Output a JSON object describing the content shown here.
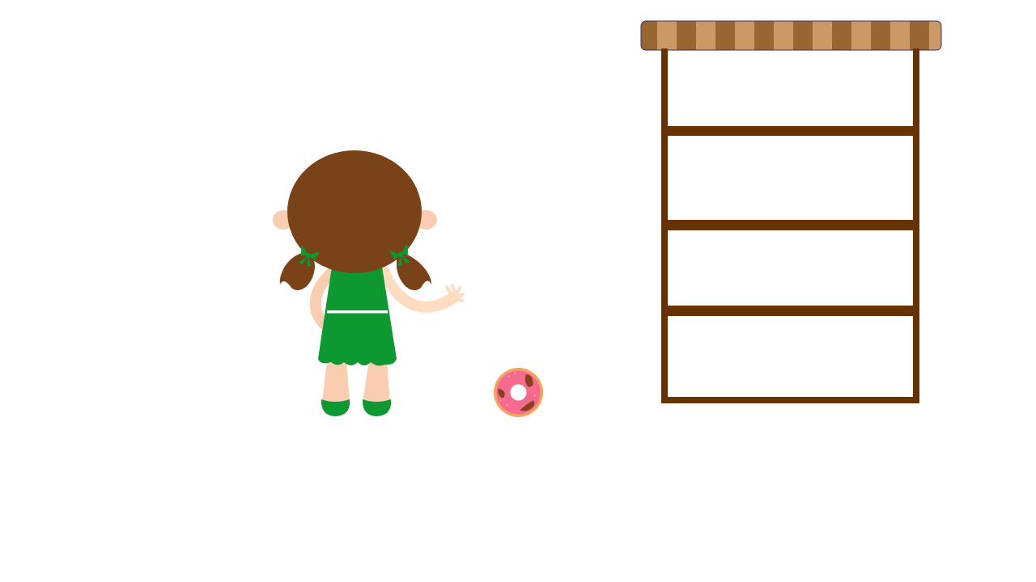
{
  "scene": {
    "background": "#ffffff"
  },
  "character": {
    "icon": "girl-back-view",
    "hair_color": "#7a4218",
    "skin_color": "#f8cdb0",
    "arm_color": "#fddcbf",
    "dress_color": "#0e9832",
    "ribbon_color": "#0e9832",
    "waist_stripe_color": "#ffffff"
  },
  "donut": {
    "icon": "donut-icon",
    "dough_color": "#f3a55f",
    "frosting_color": "#f66b8d",
    "topping_color": "#87401a"
  },
  "shelf": {
    "icon": "shelf-icon",
    "frame_color": "#663300",
    "awning_color_dark": "#996633",
    "awning_color_light": "#cc9966",
    "awning_border": "#333366",
    "compartments": 4
  }
}
